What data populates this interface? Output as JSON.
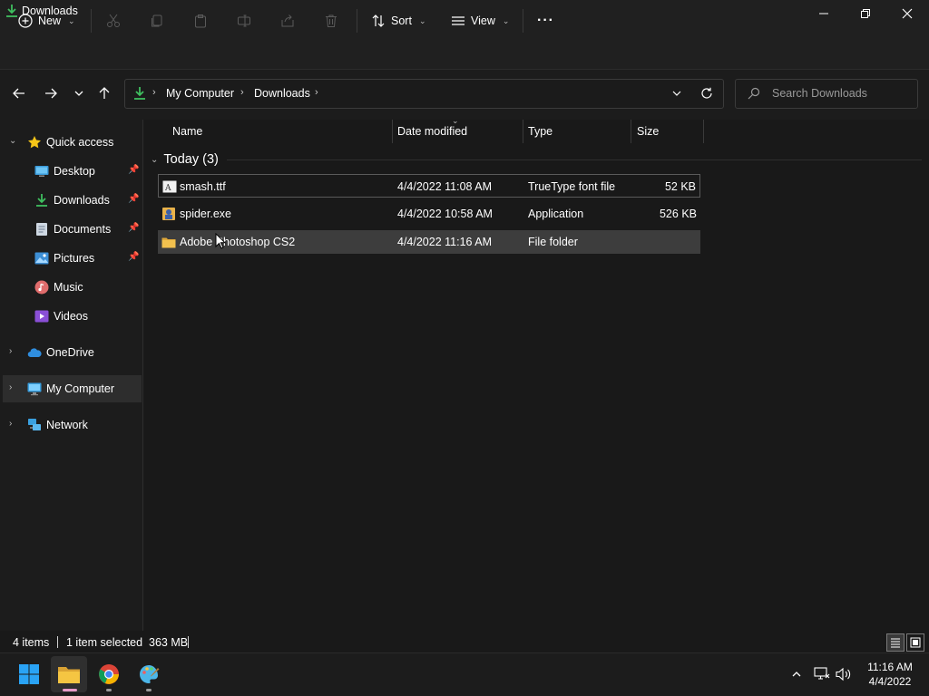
{
  "window": {
    "title": "Downloads",
    "controls": [
      "minimize",
      "restore",
      "close"
    ]
  },
  "toolbar": {
    "new_label": "New",
    "sort_label": "Sort",
    "view_label": "View",
    "more_label": "···",
    "icons": [
      "cut-icon",
      "copy-icon",
      "paste-icon",
      "rename-icon",
      "share-icon",
      "delete-icon"
    ]
  },
  "address": {
    "crumbs": [
      "My Computer",
      "Downloads"
    ],
    "search_placeholder": "Search Downloads"
  },
  "sidebar": {
    "quick_access": "Quick access",
    "quick_items": [
      {
        "label": "Desktop",
        "icon": "desktop-icon",
        "pinned": true
      },
      {
        "label": "Downloads",
        "icon": "download-icon",
        "pinned": true
      },
      {
        "label": "Documents",
        "icon": "documents-icon",
        "pinned": true
      },
      {
        "label": "Pictures",
        "icon": "pictures-icon",
        "pinned": true
      },
      {
        "label": "Music",
        "icon": "music-icon",
        "pinned": false
      },
      {
        "label": "Videos",
        "icon": "videos-icon",
        "pinned": false
      }
    ],
    "onedrive": "OneDrive",
    "my_computer": "My Computer",
    "network": "Network"
  },
  "columns": {
    "name": "Name",
    "date": "Date modified",
    "type": "Type",
    "size": "Size"
  },
  "group": {
    "label": "Today (3)"
  },
  "files": [
    {
      "name": "smash.ttf",
      "date": "4/4/2022 11:08 AM",
      "type": "TrueType font file",
      "size": "52 KB",
      "icon": "font-file-icon"
    },
    {
      "name": "spider.exe",
      "date": "4/4/2022 10:58 AM",
      "type": "Application",
      "size": "526 KB",
      "icon": "application-icon"
    },
    {
      "name": "Adobe Photoshop CS2",
      "date": "4/4/2022 11:16 AM",
      "type": "File folder",
      "size": "",
      "icon": "folder-icon"
    }
  ],
  "status": {
    "items": "4 items",
    "selected": "1 item selected  363 MB"
  },
  "taskbar": {
    "apps": [
      "windows-start-icon",
      "file-explorer-icon",
      "chrome-icon",
      "paint-icon"
    ],
    "time": "11:16 AM",
    "date": "4/4/2022"
  },
  "colors": {
    "accent_green": "#3fbf5f",
    "folder_yellow": "#f2c14e",
    "selection": "#3d3d3d"
  }
}
